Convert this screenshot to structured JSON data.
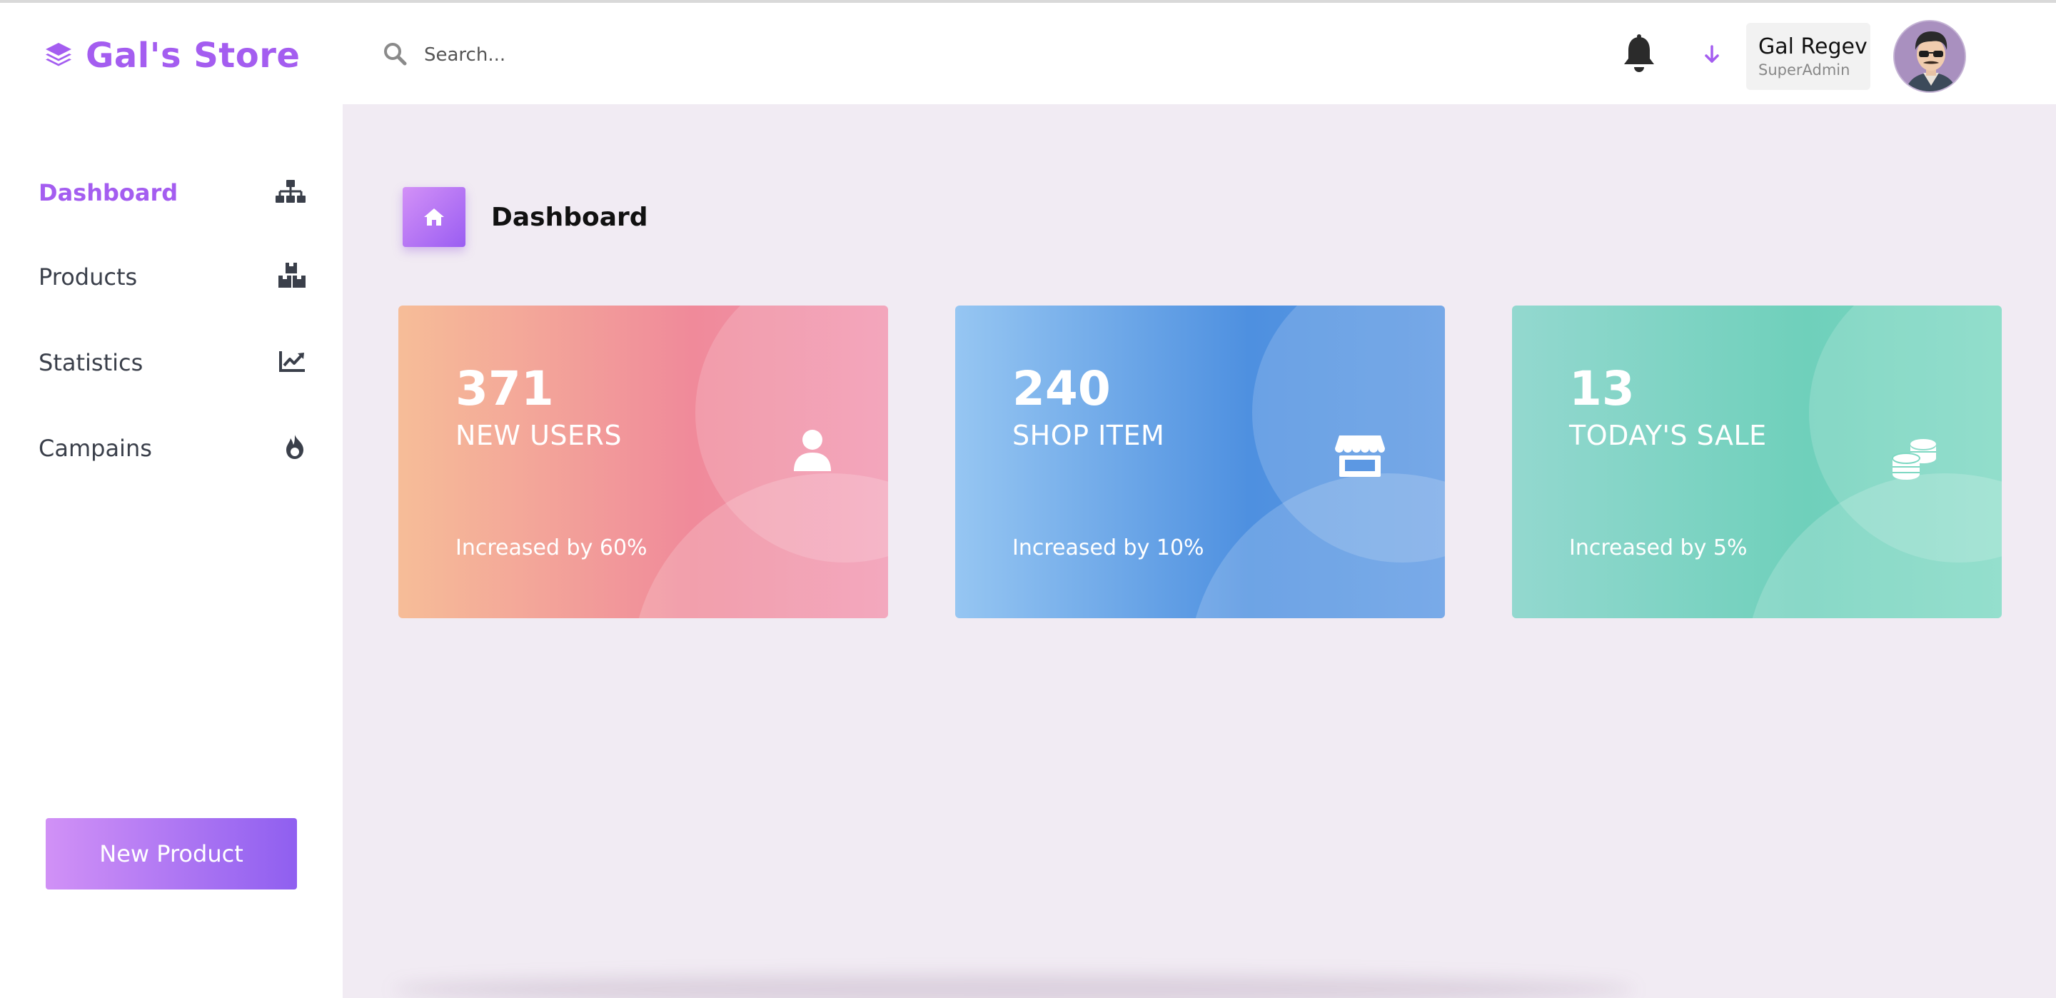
{
  "brand": {
    "name": "Gal's Store",
    "icon": "layers-icon",
    "color": "#a45df0"
  },
  "search": {
    "placeholder": "Search...",
    "value": ""
  },
  "header": {
    "notification_icon": "bell-icon",
    "dropdown_icon": "arrow-down-icon",
    "user": {
      "name": "Gal Regev",
      "role": "SuperAdmin"
    }
  },
  "sidebar": {
    "items": [
      {
        "label": "Dashboard",
        "icon": "sitemap-icon",
        "active": true
      },
      {
        "label": "Products",
        "icon": "boxes-icon",
        "active": false
      },
      {
        "label": "Statistics",
        "icon": "line-chart-icon",
        "active": false
      },
      {
        "label": "Campains",
        "icon": "fire-icon",
        "active": false
      }
    ],
    "new_product_label": "New Product"
  },
  "page": {
    "title": "Dashboard",
    "icon": "home-icon"
  },
  "cards": [
    {
      "value": "371",
      "label": "NEW USERS",
      "footer": "Increased by 60%",
      "icon": "user-icon",
      "accent": "#f08a9a"
    },
    {
      "value": "240",
      "label": "SHOP ITEM",
      "footer": "Increased by 10%",
      "icon": "store-icon",
      "accent": "#4e90e0"
    },
    {
      "value": "13",
      "label": "TODAY'S SALE",
      "footer": "Increased by 5%",
      "icon": "coins-icon",
      "accent": "#6fd0bb"
    }
  ]
}
